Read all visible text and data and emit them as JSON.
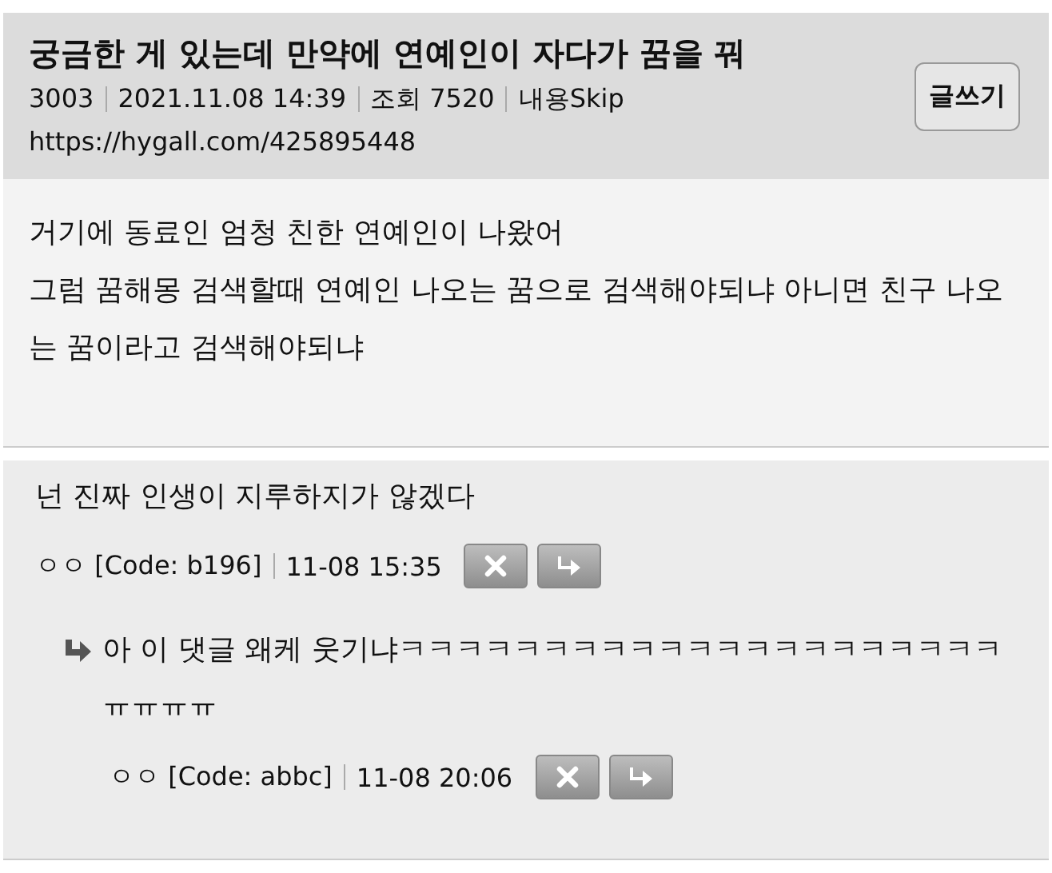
{
  "post": {
    "title": "궁금한 게 있는데 만약에 연예인이 자다가 꿈을 꿔",
    "meta": [
      "3003",
      "2021.11.08 14:39",
      "조회 7520",
      "내용Skip"
    ],
    "url": "https://hygall.com/425895448",
    "write_button": "글쓰기",
    "body": [
      "거기에 동료인 엄청 친한 연예인이 나왔어",
      "그럼 꿈해몽 검색할때 연예인 나오는 꿈으로 검색해야되냐 아니면 친구 나오는 꿈이라고 검색해야되냐"
    ]
  },
  "comments": [
    {
      "text": "넌 진짜 인생이 지루하지가 않겠다",
      "author": "ㅇㅇ [Code: b196]",
      "time": "11-08 15:35",
      "children": [
        {
          "text": "아 이 댓글 왜케 웃기냐ㅋㅋㅋㅋㅋㅋㅋㅋㅋㅋㅋㅋㅋㅋㅋㅋㅋㅋㅋㅋㅋㅠㅠㅠㅠ",
          "author": "ㅇㅇ [Code: abbc]",
          "time": "11-08 20:06"
        }
      ]
    }
  ]
}
